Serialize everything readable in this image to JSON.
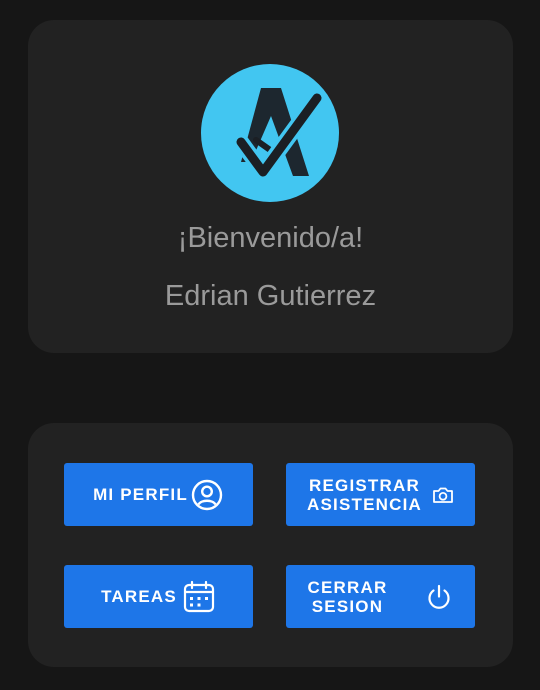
{
  "welcome": {
    "greeting": "¡Bienvenido/a!",
    "user_name": "Edrian Gutierrez",
    "logo_icon": "app-logo-a-check"
  },
  "actions": {
    "profile": {
      "label": "MI PERFIL",
      "icon": "user-circle-icon"
    },
    "attendance": {
      "line1": "REGISTRAR",
      "line2": "ASISTENCIA",
      "icon": "camera-icon"
    },
    "tasks": {
      "label": "TAREAS",
      "icon": "calendar-icon"
    },
    "logout": {
      "line1": "CERRAR",
      "line2": "SESION",
      "icon": "power-icon"
    }
  },
  "colors": {
    "background": "#161616",
    "card": "#222222",
    "button": "#1e76e8",
    "logo": "#42c6f1",
    "text_muted": "#9a9a9a"
  }
}
